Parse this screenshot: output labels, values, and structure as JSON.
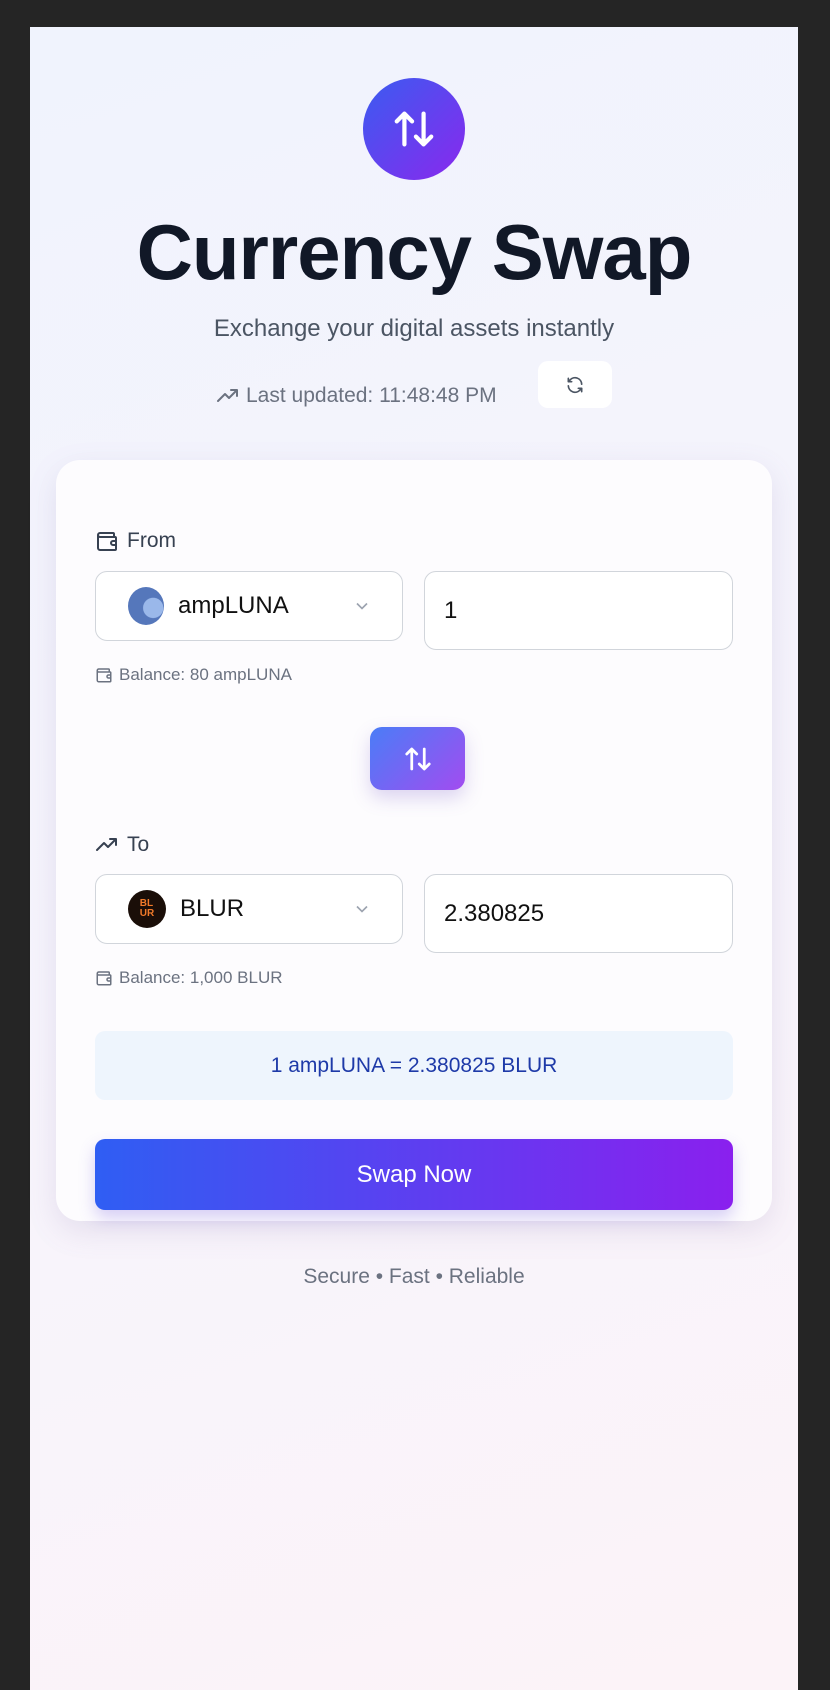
{
  "header": {
    "title": "Currency Swap",
    "subtitle": "Exchange your digital assets instantly",
    "last_updated": "Last updated: 11:48:48 PM"
  },
  "from": {
    "label": "From",
    "token": "ampLUNA",
    "amount": "1",
    "balance": "Balance: 80 ampLUNA"
  },
  "to": {
    "label": "To",
    "token": "BLUR",
    "amount": "2.380825",
    "balance": "Balance: 1,000 BLUR"
  },
  "rate": "1 ampLUNA = 2.380825 BLUR",
  "swap_button": "Swap Now",
  "footer": "Secure • Fast • Reliable",
  "colors": {
    "accent_start": "#2f5ef3",
    "accent_end": "#8a20ee",
    "rate_text": "#1e3aa8"
  }
}
